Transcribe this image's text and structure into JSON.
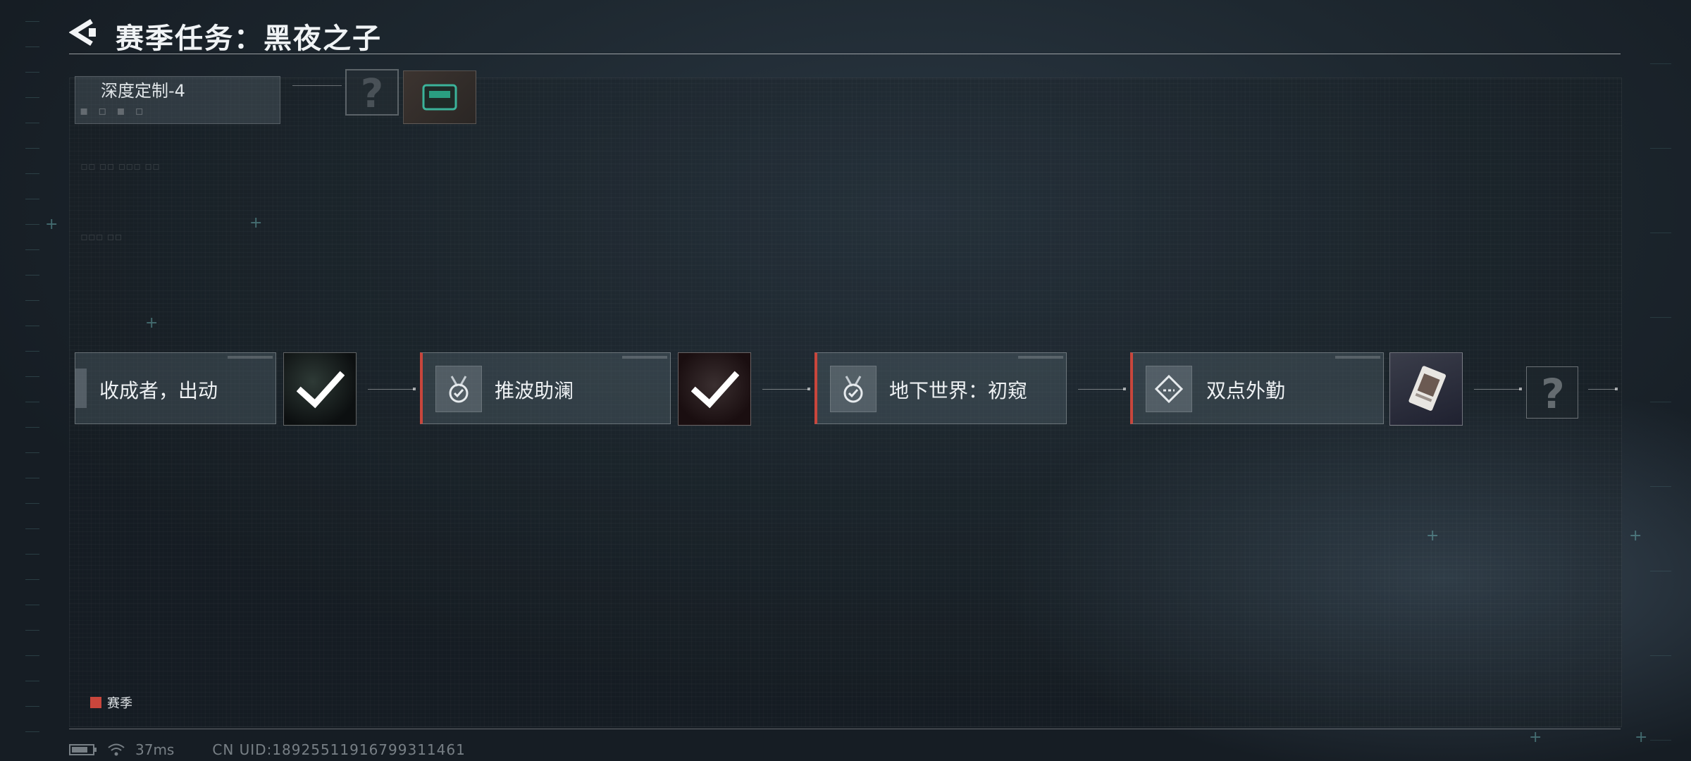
{
  "header": {
    "title": "赛季任务：黑夜之子"
  },
  "top_row": {
    "partial_label": "深度定制-4"
  },
  "missions": [
    {
      "label": "收成者，出动",
      "season": false,
      "reward": "claimed"
    },
    {
      "label": "推波助澜",
      "season": true,
      "reward": "claimed"
    },
    {
      "label": "地下世界：初窥",
      "season": true,
      "reward": "none"
    },
    {
      "label": "双点外勤",
      "season": true,
      "reward": "card"
    }
  ],
  "unknown_reward": {
    "glyph": "?"
  },
  "legend": {
    "label": "赛季",
    "color": "#c9463c"
  },
  "footer": {
    "ping": "37ms",
    "uid": "CN UID:18925511916799311461"
  },
  "icons": [
    "back-arrow-icon",
    "medal-icon",
    "diamond-icon",
    "checkmark-icon",
    "battery-icon",
    "wifi-icon"
  ]
}
